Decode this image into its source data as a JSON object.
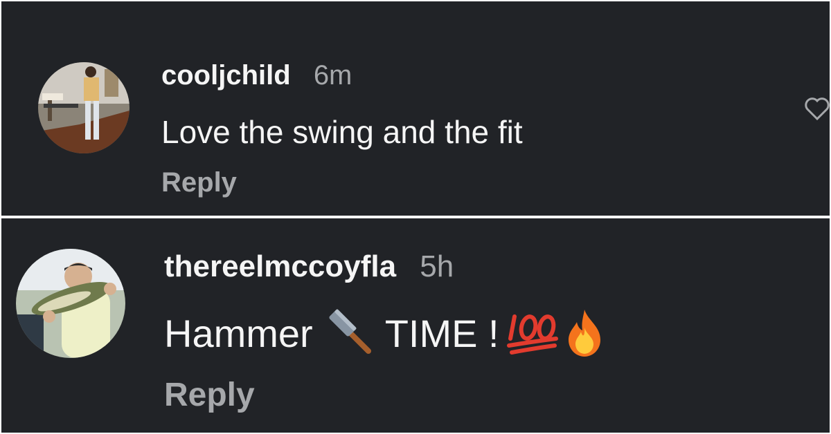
{
  "comments": [
    {
      "username": "cooljchild",
      "time": "6m",
      "text": "Love the swing and the fit",
      "reply_label": "Reply"
    },
    {
      "username": "thereelmccoyfla",
      "time": "5h",
      "text_before": "Hammer",
      "text_after": "TIME !",
      "emojis": [
        "hammer-icon",
        "hundred-points-icon",
        "fire-icon"
      ],
      "reply_label": "Reply"
    }
  ],
  "colors": {
    "background": "#212327",
    "primary_text": "#f5f5f5",
    "secondary_text": "#a6a8ab"
  }
}
